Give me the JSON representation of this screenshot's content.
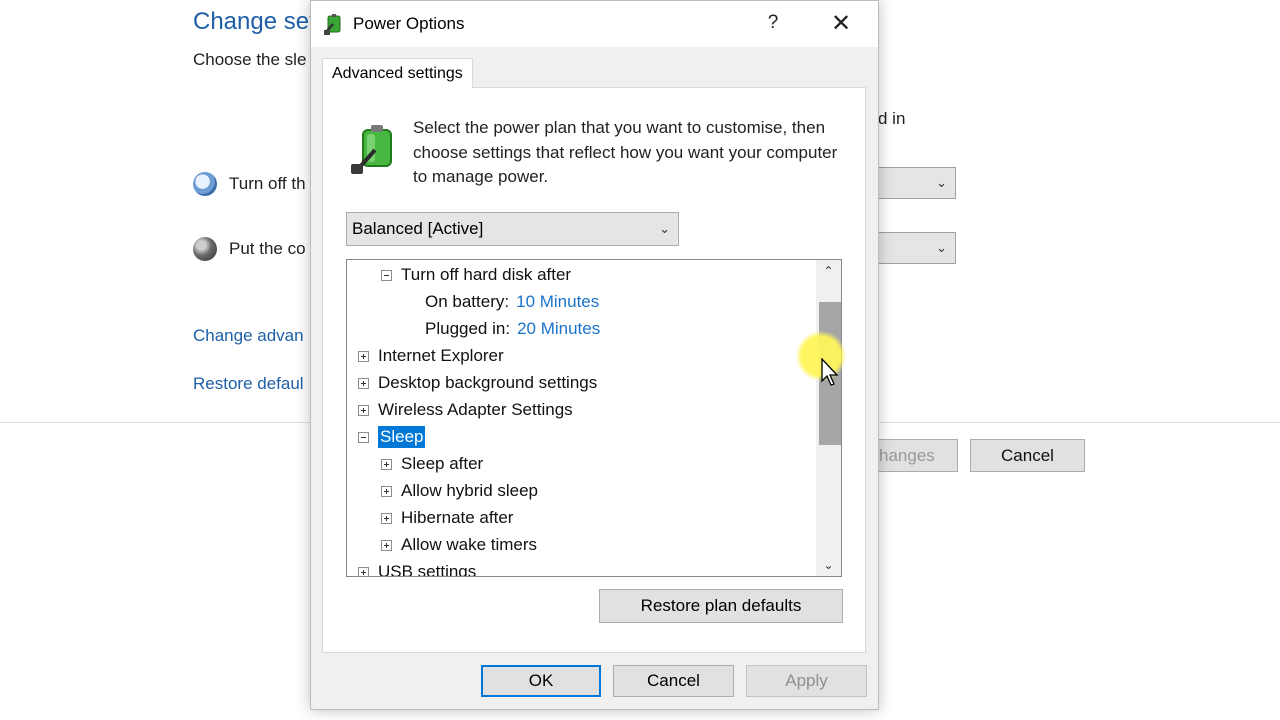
{
  "background": {
    "title": "Change set",
    "subtitle": "Choose the sle",
    "right_text": "d in",
    "row1_label": "Turn off th",
    "row2_label": "Put the co",
    "link_advanced": "Change advan",
    "link_restore": "Restore defaul",
    "save_label": "hanges",
    "cancel_label": "Cancel"
  },
  "dialog": {
    "title": "Power Options",
    "help": "?",
    "close": "✕",
    "tab_label": "Advanced settings",
    "intro": "Select the power plan that you want to customise, then choose settings that reflect how you want your computer to manage power.",
    "plan_selected": "Balanced [Active]",
    "tree": {
      "hard_disk": "Turn off hard disk after",
      "on_battery_label": "On battery:",
      "on_battery_value": "10 Minutes",
      "plugged_in_label": "Plugged in:",
      "plugged_in_value": "20 Minutes",
      "internet_explorer": "Internet Explorer",
      "desktop_background": "Desktop background settings",
      "wireless_adapter": "Wireless Adapter Settings",
      "sleep": "Sleep",
      "sleep_after": "Sleep after",
      "hybrid_sleep": "Allow hybrid sleep",
      "hibernate_after": "Hibernate after",
      "wake_timers": "Allow wake timers",
      "usb_settings": "USB settings"
    },
    "restore_defaults": "Restore plan defaults",
    "ok": "OK",
    "cancel": "Cancel",
    "apply": "Apply"
  },
  "colors": {
    "link": "#1e5fa8",
    "value": "#1a73c9",
    "selection": "#0078d7",
    "cursor_highlight": "#fff55a"
  }
}
